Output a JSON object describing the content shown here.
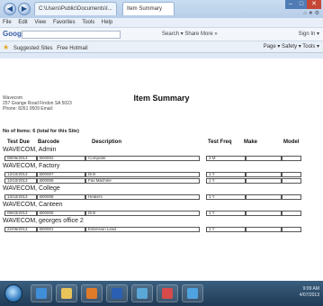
{
  "browser": {
    "address": "C:\\Users\\Public\\Documents\\I...",
    "tab_label": "Item Summary",
    "menu": [
      "File",
      "Edit",
      "View",
      "Favorites",
      "Tools",
      "Help"
    ],
    "google_label": "Google",
    "favorites": [
      "Suggested Sites",
      "Free Hotmail"
    ],
    "toolbar_right": "Page ▾   Safety ▾   Tools ▾",
    "google_tools": "Search ▾    Share   More »",
    "signin": "Sign In ▾"
  },
  "report": {
    "company": [
      "Wavecom",
      "257 Grange Road Findon SA 5023",
      "Phone: 8261 0509   Email:"
    ],
    "title": "Item Summary",
    "items_count": "No of Items: 6 (total for this Site)",
    "columns": {
      "test_due": "Test Due",
      "barcode": "Barcode",
      "description": "Description",
      "test_freq": "Test Freq",
      "make": "Make",
      "model": "Model"
    },
    "groups": [
      {
        "name": "WAVECOM, Admin",
        "rows": [
          {
            "date": "08/06/2013",
            "barcode": "B00002",
            "desc": "Computer",
            "freq": "3 M",
            "make": "",
            "model": ""
          }
        ]
      },
      {
        "name": "WAVECOM, Factory",
        "rows": [
          {
            "date": "12/10/2013",
            "barcode": "B00007",
            "desc": "Drill",
            "freq": "1 Y",
            "make": "",
            "model": ""
          },
          {
            "date": "12/10/2013",
            "barcode": "B00006",
            "desc": "Fax Machine",
            "freq": "1 Y",
            "make": "",
            "model": ""
          }
        ]
      },
      {
        "name": "WAVECOM, College",
        "rows": [
          {
            "date": "13/10/2013",
            "barcode": "B00008",
            "desc": "Heaters",
            "freq": "1 Y",
            "make": "",
            "model": ""
          }
        ]
      },
      {
        "name": "WAVECOM, Canteen",
        "rows": [
          {
            "date": "09/03/2013",
            "barcode": "B00005",
            "desc": "Drill",
            "freq": "1 Y",
            "make": "",
            "model": ""
          }
        ]
      },
      {
        "name": "WAVECOM, georges office 2",
        "rows": [
          {
            "date": "22/06/2013",
            "barcode": "B00001",
            "desc": "Extension Lead",
            "freq": "1 Y",
            "make": "",
            "model": ""
          }
        ]
      }
    ]
  },
  "taskbar": {
    "clock": "9:09 AM",
    "date": "4/07/2013",
    "apps": [
      {
        "name": "ie",
        "color": "#3f8ed8"
      },
      {
        "name": "folder",
        "color": "#e8c35a"
      },
      {
        "name": "media",
        "color": "#e07b2a"
      },
      {
        "name": "word",
        "color": "#2b5fb3"
      },
      {
        "name": "app",
        "color": "#5aa8d8"
      },
      {
        "name": "paint",
        "color": "#d84b4b"
      },
      {
        "name": "explorer",
        "color": "#4fa3e0"
      }
    ]
  }
}
